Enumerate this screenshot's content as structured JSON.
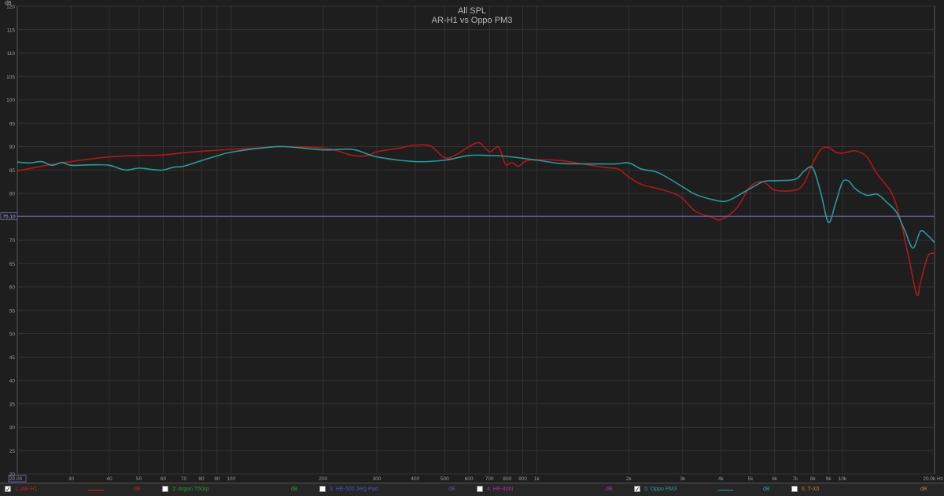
{
  "chart_data": {
    "type": "line",
    "title": "All SPL",
    "subtitle": "AR-H1 vs Oppo PM3",
    "ylabel": "dB",
    "xlabel": "Hz",
    "x_scale": "log",
    "xlim": [
      20,
      20000
    ],
    "ylim": [
      20,
      120
    ],
    "grid": true,
    "y_ticks": [
      120,
      115,
      110,
      105,
      100,
      95,
      90,
      85,
      80,
      75,
      70,
      65,
      60,
      55,
      50,
      45,
      40,
      35,
      30,
      25,
      20
    ],
    "x_ticks": [
      {
        "v": 20,
        "label": "20.00"
      },
      {
        "v": 30,
        "label": "30"
      },
      {
        "v": 40,
        "label": "40"
      },
      {
        "v": 50,
        "label": "50"
      },
      {
        "v": 60,
        "label": "60"
      },
      {
        "v": 70,
        "label": "70"
      },
      {
        "v": 80,
        "label": "80"
      },
      {
        "v": 90,
        "label": "90"
      },
      {
        "v": 100,
        "label": "100"
      },
      {
        "v": 200,
        "label": "200"
      },
      {
        "v": 300,
        "label": "300"
      },
      {
        "v": 400,
        "label": "400"
      },
      {
        "v": 500,
        "label": "500"
      },
      {
        "v": 600,
        "label": "600"
      },
      {
        "v": 700,
        "label": "700"
      },
      {
        "v": 800,
        "label": "800"
      },
      {
        "v": 900,
        "label": "900"
      },
      {
        "v": 1000,
        "label": "1k"
      },
      {
        "v": 2000,
        "label": "2k"
      },
      {
        "v": 3000,
        "label": "3k"
      },
      {
        "v": 4000,
        "label": "4k"
      },
      {
        "v": 5000,
        "label": "5k"
      },
      {
        "v": 6000,
        "label": "6k"
      },
      {
        "v": 7000,
        "label": "7k"
      },
      {
        "v": 8000,
        "label": "8k"
      },
      {
        "v": 9000,
        "label": "9k"
      },
      {
        "v": 10000,
        "label": "10k"
      },
      {
        "v": 20000,
        "label": "20.0k Hz"
      }
    ],
    "reference_line": {
      "value": 75.1,
      "label": "75.10",
      "color": "#7070c0"
    },
    "series": [
      {
        "name": "1: AR-H1",
        "color": "#b01818",
        "points": [
          [
            20,
            84.8
          ],
          [
            25,
            86
          ],
          [
            30,
            86.8
          ],
          [
            40,
            87.8
          ],
          [
            50,
            88.1
          ],
          [
            60,
            88.2
          ],
          [
            70,
            88.7
          ],
          [
            80,
            89
          ],
          [
            100,
            89.4
          ],
          [
            130,
            89.8
          ],
          [
            150,
            90
          ],
          [
            200,
            89.7
          ],
          [
            220,
            89.2
          ],
          [
            250,
            88.1
          ],
          [
            280,
            88.1
          ],
          [
            300,
            88.9
          ],
          [
            350,
            89.6
          ],
          [
            400,
            90.3
          ],
          [
            450,
            90.1
          ],
          [
            500,
            87.6
          ],
          [
            550,
            88.4
          ],
          [
            600,
            90
          ],
          [
            650,
            90.8
          ],
          [
            700,
            88.9
          ],
          [
            750,
            89.9
          ],
          [
            790,
            86.2
          ],
          [
            830,
            86.6
          ],
          [
            870,
            85.8
          ],
          [
            920,
            86.9
          ],
          [
            1000,
            87.2
          ],
          [
            1200,
            87
          ],
          [
            1500,
            86
          ],
          [
            1700,
            85.5
          ],
          [
            1850,
            85.2
          ],
          [
            2000,
            83.5
          ],
          [
            2200,
            81.9
          ],
          [
            2500,
            81
          ],
          [
            2800,
            80
          ],
          [
            3000,
            78.9
          ],
          [
            3300,
            76.2
          ],
          [
            3700,
            75
          ],
          [
            4000,
            74.4
          ],
          [
            4500,
            76.8
          ],
          [
            5000,
            81.5
          ],
          [
            5500,
            82.5
          ],
          [
            6000,
            80.7
          ],
          [
            7000,
            80.7
          ],
          [
            7500,
            82.3
          ],
          [
            8000,
            86.5
          ],
          [
            8500,
            89.4
          ],
          [
            9000,
            89.8
          ],
          [
            9500,
            88.8
          ],
          [
            10000,
            88.6
          ],
          [
            11000,
            89.1
          ],
          [
            12000,
            87.8
          ],
          [
            13000,
            84.1
          ],
          [
            14500,
            80
          ],
          [
            15500,
            74
          ],
          [
            16500,
            66
          ],
          [
            17500,
            58.3
          ],
          [
            18000,
            61
          ],
          [
            19000,
            66.5
          ],
          [
            20000,
            67.2
          ]
        ]
      },
      {
        "name": "5: Oppo PM3",
        "color": "#2a9a9a",
        "points": [
          [
            20,
            86.7
          ],
          [
            22,
            86.5
          ],
          [
            24,
            86.8
          ],
          [
            26,
            86
          ],
          [
            28,
            86.6
          ],
          [
            30,
            86
          ],
          [
            35,
            86.1
          ],
          [
            40,
            86
          ],
          [
            45,
            85
          ],
          [
            50,
            85.4
          ],
          [
            55,
            85.1
          ],
          [
            60,
            85
          ],
          [
            65,
            85.6
          ],
          [
            70,
            85.8
          ],
          [
            80,
            87
          ],
          [
            90,
            88
          ],
          [
            100,
            88.8
          ],
          [
            130,
            89.8
          ],
          [
            150,
            90
          ],
          [
            200,
            89.3
          ],
          [
            250,
            89.4
          ],
          [
            300,
            87.8
          ],
          [
            400,
            86.8
          ],
          [
            500,
            87.1
          ],
          [
            600,
            88.1
          ],
          [
            700,
            88.1
          ],
          [
            800,
            87.9
          ],
          [
            1000,
            87.1
          ],
          [
            1200,
            86.4
          ],
          [
            1500,
            86.3
          ],
          [
            1800,
            86.3
          ],
          [
            2000,
            86.5
          ],
          [
            2200,
            85.2
          ],
          [
            2500,
            84.4
          ],
          [
            3000,
            81.4
          ],
          [
            3300,
            79.8
          ],
          [
            3800,
            78.6
          ],
          [
            4200,
            78.4
          ],
          [
            4800,
            80.4
          ],
          [
            5500,
            82.5
          ],
          [
            6000,
            82.7
          ],
          [
            7000,
            83
          ],
          [
            7500,
            84.8
          ],
          [
            8000,
            85.4
          ],
          [
            8500,
            80
          ],
          [
            9000,
            73.8
          ],
          [
            9500,
            78
          ],
          [
            10000,
            82.4
          ],
          [
            10500,
            82.6
          ],
          [
            11000,
            81
          ],
          [
            12000,
            79.6
          ],
          [
            13000,
            79.8
          ],
          [
            14000,
            78
          ],
          [
            15000,
            76
          ],
          [
            16000,
            72
          ],
          [
            17000,
            68.3
          ],
          [
            18000,
            71.9
          ],
          [
            19000,
            71
          ],
          [
            20000,
            69.5
          ]
        ]
      }
    ]
  },
  "legend": [
    {
      "label": "1: AR-H1",
      "checked": true,
      "color": "#c02020",
      "unit": "dB",
      "has_line": true
    },
    {
      "label": "2: Argon T50rp",
      "checked": false,
      "color": "#2a9a2a",
      "unit": "dB",
      "has_line": false
    },
    {
      "label": "3: HE-500 Jerg Pad",
      "checked": false,
      "color": "#5050c0",
      "unit": "dB",
      "has_line": false
    },
    {
      "label": "4: HE-400i",
      "checked": false,
      "color": "#b030b0",
      "unit": "dB",
      "has_line": false
    },
    {
      "label": "5: Oppo PM3",
      "checked": true,
      "color": "#2a9a9a",
      "unit": "dB",
      "has_line": true
    },
    {
      "label": "6: T-X0",
      "checked": false,
      "color": "#c08020",
      "unit": "dB",
      "has_line": false
    }
  ]
}
